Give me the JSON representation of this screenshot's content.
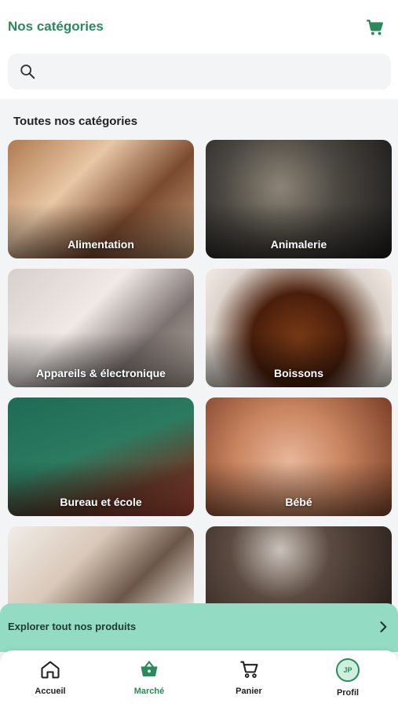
{
  "header": {
    "title": "Nos catégories",
    "cart_icon": "cart-icon"
  },
  "search": {
    "placeholder": "",
    "value": "",
    "icon": "search-icon"
  },
  "section": {
    "title": "Toutes nos catégories"
  },
  "categories": [
    {
      "label": "Alimentation"
    },
    {
      "label": "Animalerie"
    },
    {
      "label": "Appareils & électronique"
    },
    {
      "label": "Boissons"
    },
    {
      "label": "Bureau et école"
    },
    {
      "label": "Bébé"
    },
    {
      "label": ""
    },
    {
      "label": ""
    }
  ],
  "explore": {
    "label": "Explorer tout nos produits"
  },
  "bottom_nav": {
    "items": [
      {
        "label": "Accueil",
        "icon": "home-icon"
      },
      {
        "label": "Marché",
        "icon": "basket-icon"
      },
      {
        "label": "Panier",
        "icon": "cart-icon"
      },
      {
        "label": "Profil",
        "icon": "avatar",
        "initials": "JP"
      }
    ],
    "active_color": "#2a8a5c"
  },
  "colors": {
    "brand_green": "#2a8a5c",
    "explore_bar": "#93dcc3"
  }
}
